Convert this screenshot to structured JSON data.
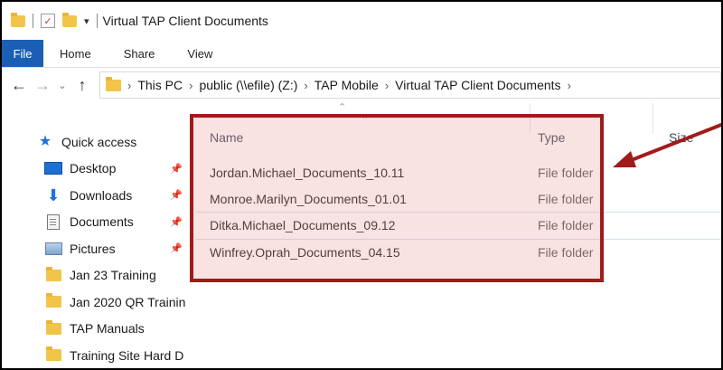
{
  "window": {
    "title": "Virtual TAP Client Documents"
  },
  "ribbon": {
    "tabs": [
      "File",
      "Home",
      "Share",
      "View"
    ]
  },
  "address": {
    "crumbs": [
      "This PC",
      "public (\\\\efile) (Z:)",
      "TAP Mobile",
      "Virtual TAP Client Documents"
    ]
  },
  "sidebar": {
    "items": [
      {
        "label": "Quick access",
        "icon": "star-icon"
      },
      {
        "label": "Desktop",
        "icon": "desktop-icon",
        "pinned": true
      },
      {
        "label": "Downloads",
        "icon": "download-icon",
        "pinned": true
      },
      {
        "label": "Documents",
        "icon": "documents-icon",
        "pinned": true
      },
      {
        "label": "Pictures",
        "icon": "pictures-icon",
        "pinned": true
      },
      {
        "label": "Jan 23 Training",
        "icon": "folder-icon"
      },
      {
        "label": "Jan 2020 QR Trainin",
        "icon": "folder-icon"
      },
      {
        "label": "TAP Manuals",
        "icon": "folder-icon"
      },
      {
        "label": "Training Site Hard D",
        "icon": "folder-icon"
      }
    ]
  },
  "columns": {
    "name": "Name",
    "type": "Type",
    "size": "Size"
  },
  "files": [
    {
      "name": "Jordan.Michael_Documents_10.11",
      "type": "File folder"
    },
    {
      "name": "Monroe.Marilyn_Documents_01.01",
      "type": "File folder"
    },
    {
      "name": "Ditka.Michael_Documents_09.12",
      "type": "File folder"
    },
    {
      "name": "Winfrey.Oprah_Documents_04.15",
      "type": "File folder"
    }
  ],
  "colors": {
    "accent": "#1a5fb4",
    "annotation": "#a11b1b",
    "folder": "#f3c44a"
  }
}
